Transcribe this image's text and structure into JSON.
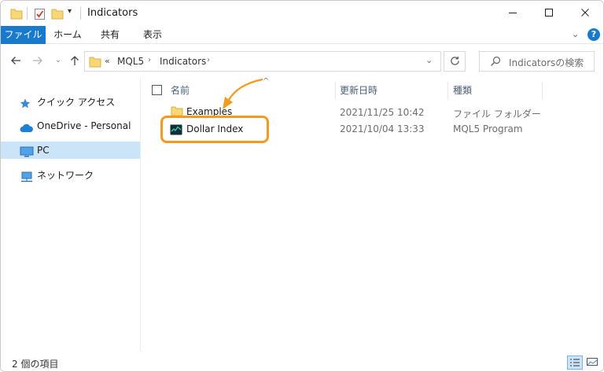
{
  "window": {
    "title": "Indicators",
    "controls": {
      "minimize": "—",
      "maximize": "☐",
      "close": "✕"
    }
  },
  "ribbon": {
    "tabs": [
      {
        "label": "ファイル",
        "active": true
      },
      {
        "label": "ホーム",
        "active": false
      },
      {
        "label": "共有",
        "active": false
      },
      {
        "label": "表示",
        "active": false
      }
    ],
    "help_label": "?"
  },
  "address_bar": {
    "overflow": "«",
    "segments": [
      "MQL5",
      "Indicators"
    ],
    "search_placeholder": "Indicatorsの検索"
  },
  "sidebar": {
    "items": [
      {
        "label": "クイック アクセス",
        "icon": "star-pin-icon",
        "selected": false
      },
      {
        "label": "OneDrive - Personal",
        "icon": "cloud-icon",
        "selected": false
      },
      {
        "label": "PC",
        "icon": "monitor-icon",
        "selected": true
      },
      {
        "label": "ネットワーク",
        "icon": "network-icon",
        "selected": false
      }
    ]
  },
  "file_list": {
    "columns": {
      "name": "名前",
      "date": "更新日時",
      "type": "種類"
    },
    "rows": [
      {
        "name": "Examples",
        "date": "2021/11/25 10:42",
        "type": "ファイル フォルダー",
        "icon": "folder-icon"
      },
      {
        "name": "Dollar Index",
        "date": "2021/10/04 13:33",
        "type": "MQL5 Program",
        "icon": "mql5-program-icon"
      }
    ]
  },
  "status_bar": {
    "item_count": "2 個の項目"
  },
  "colors": {
    "accent": "#1979ca",
    "highlight": "#f39a1f",
    "selected_bg": "#cce4f7"
  }
}
